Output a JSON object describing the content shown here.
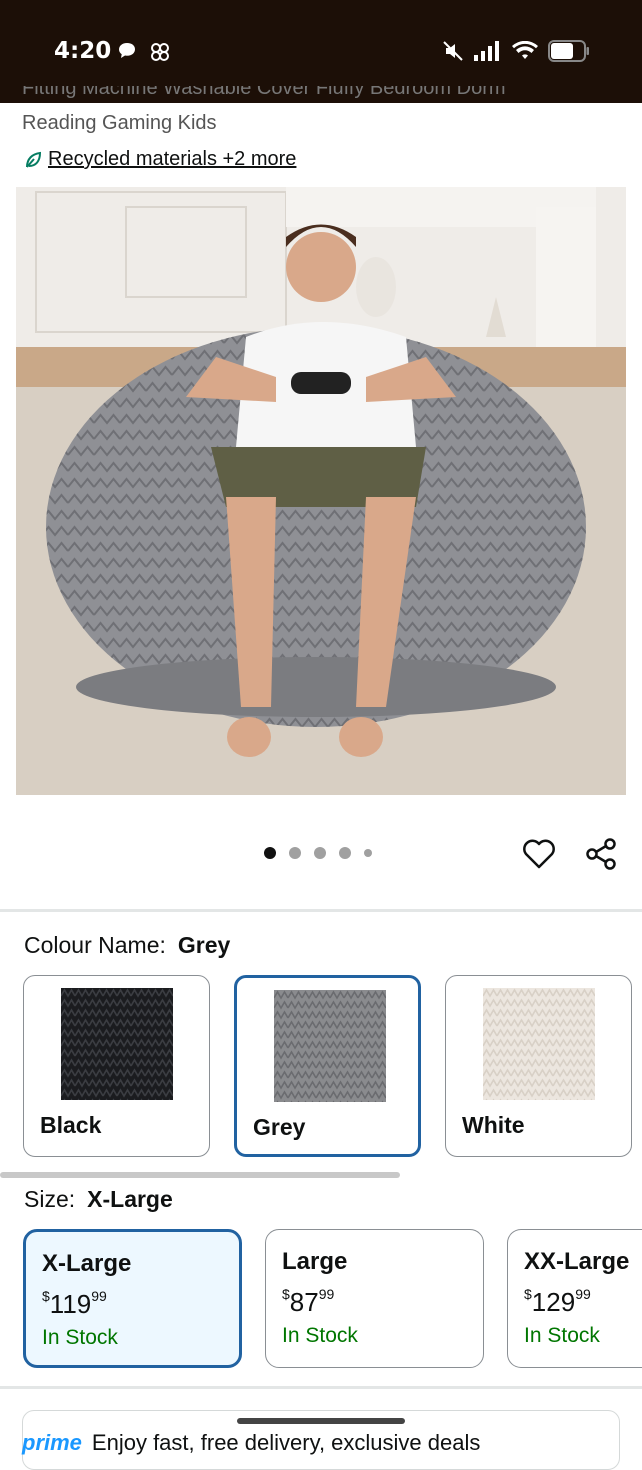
{
  "status_bar": {
    "time": "4:20",
    "icons_left": [
      "chat-bubble-icon",
      "pinwheel-icon"
    ],
    "icons_right": [
      "mute-icon",
      "signal-icon",
      "wifi-icon",
      "battery-icon"
    ]
  },
  "product": {
    "title_partial_top": "Fitting Machine Washable Cover Fluffy Bedroom Dorm",
    "title_partial_bottom": "Reading Gaming Kids",
    "eco_link": "Recycled materials +2 more",
    "image_alt": "Grey bean bag chair with man holding game controller",
    "image_dots": 5,
    "image_active_dot": 0
  },
  "colour": {
    "label": "Colour Name:",
    "selected": "Grey",
    "options": [
      {
        "name": "Black",
        "color": "#1b1c1f"
      },
      {
        "name": "Grey",
        "color": "#8a8b8e"
      },
      {
        "name": "White",
        "color": "#ece6df"
      }
    ]
  },
  "size": {
    "label": "Size:",
    "selected": "X-Large",
    "options": [
      {
        "name": "X-Large",
        "dollars": "119",
        "cents": "99",
        "stock": "In Stock"
      },
      {
        "name": "Large",
        "dollars": "87",
        "cents": "99",
        "stock": "In Stock"
      },
      {
        "name": "XX-Large",
        "dollars": "129",
        "cents": "99",
        "stock": "In Stock"
      }
    ]
  },
  "prime": {
    "text": "Enjoy fast, free delivery, exclusive deals"
  },
  "colors": {
    "selected_border": "#2162a1",
    "in_stock": "#007600",
    "status_bar_bg": "#1c0f07"
  }
}
